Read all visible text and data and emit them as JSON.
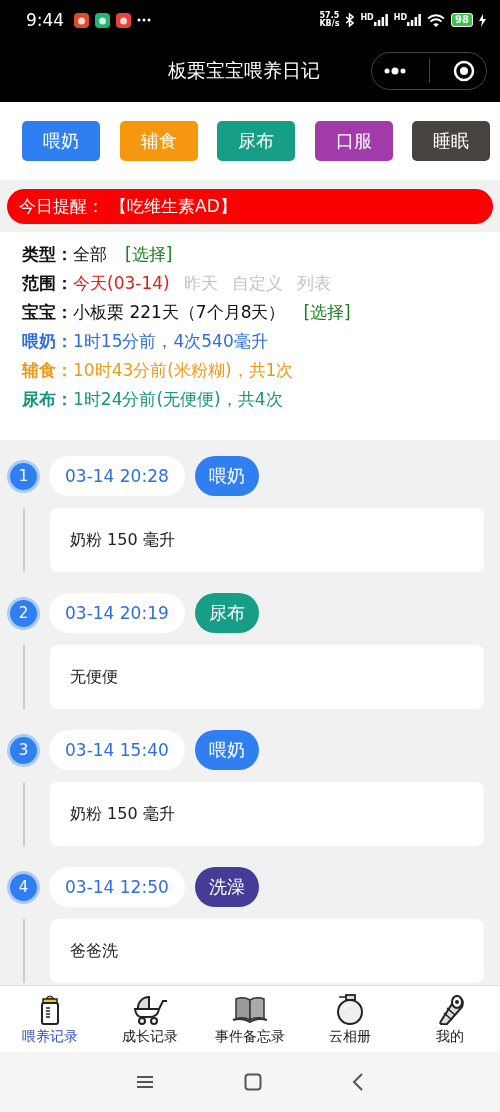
{
  "status_bar": {
    "time": "9:44",
    "net_speed": "57.5",
    "net_unit": "KB/s",
    "signal_labels": [
      "HD",
      "HD"
    ],
    "battery": "98"
  },
  "nav_bar": {
    "title": "板栗宝宝喂养日记"
  },
  "categories": [
    {
      "label": "喂奶",
      "color": "#2f7ff0"
    },
    {
      "label": "辅食",
      "color": "#f5980f"
    },
    {
      "label": "尿布",
      "color": "#179e86"
    },
    {
      "label": "口服",
      "color": "#a13ba9"
    },
    {
      "label": "睡眠",
      "color": "#48433f"
    }
  ],
  "reminder": {
    "label": "今日提醒：",
    "text": "【吃维生素AD】"
  },
  "info": [
    {
      "kind": "plain",
      "label": "类型：",
      "value": "全部",
      "link": "[选择]",
      "color": "#111111"
    },
    {
      "kind": "range",
      "label": "范围：",
      "color": "#111111",
      "options": [
        {
          "label": "今天(03-14)",
          "selected": true
        },
        {
          "label": "昨天",
          "selected": false
        },
        {
          "label": "自定义",
          "selected": false
        },
        {
          "label": "列表",
          "selected": false
        }
      ]
    },
    {
      "kind": "plain",
      "label": "宝宝：",
      "value": "小板栗 221天（7个月8天）",
      "link": "[选择]",
      "color": "#111111"
    },
    {
      "kind": "plain",
      "label": "喂奶：",
      "value": "1时15分前，4次540毫升",
      "color": "#2f6fd8"
    },
    {
      "kind": "plain",
      "label": "辅食：",
      "value": "10时43分前(米粉糊)，共1次",
      "color": "#ec9a1c"
    },
    {
      "kind": "plain",
      "label": "尿布：",
      "value": "1时24分前(无便便)，共4次",
      "color": "#16967e"
    }
  ],
  "records": [
    {
      "index": "1",
      "time": "03-14 20:28",
      "type": "喂奶",
      "color": "#2f7ff0",
      "note": "奶粉 150 毫升"
    },
    {
      "index": "2",
      "time": "03-14 20:19",
      "type": "尿布",
      "color": "#179e86",
      "note": "无便便"
    },
    {
      "index": "3",
      "time": "03-14 15:40",
      "type": "喂奶",
      "color": "#2f7ff0",
      "note": "奶粉 150 毫升"
    },
    {
      "index": "4",
      "time": "03-14 12:50",
      "type": "洗澡",
      "color": "#443c96",
      "note": "爸爸洗"
    }
  ],
  "tab_bar": [
    {
      "kind": "bottle",
      "label": "喂养记录",
      "selected": true
    },
    {
      "kind": "stroller",
      "label": "成长记录",
      "selected": false
    },
    {
      "kind": "book",
      "label": "事件备忘录",
      "selected": false
    },
    {
      "kind": "jar",
      "label": "云相册",
      "selected": false
    },
    {
      "kind": "roll",
      "label": "我的",
      "selected": false
    }
  ]
}
